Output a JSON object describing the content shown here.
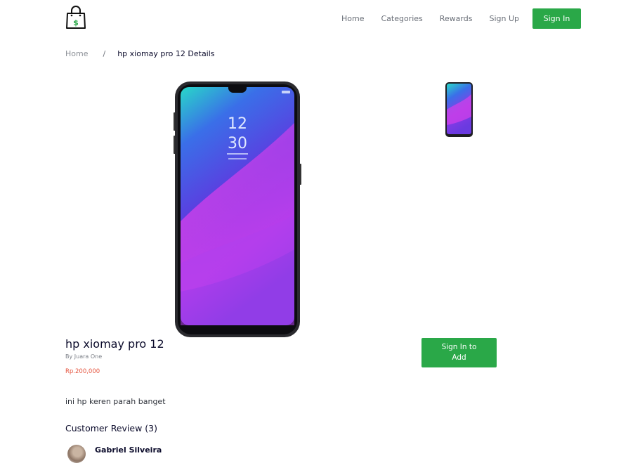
{
  "header": {
    "logo_icon": "shopping-bag-dollar-icon",
    "nav": [
      "Home",
      "Categories",
      "Rewards",
      "Sign Up"
    ],
    "sign_in_label": "Sign In"
  },
  "breadcrumb": {
    "home": "Home",
    "separator": "/",
    "current": "hp xiomay pro 12 Details"
  },
  "product": {
    "name": "hp xiomay pro 12",
    "seller": "By Juara One",
    "price": "Rp.200,000",
    "add_label": "Sign In to Add",
    "description": "ini hp keren parah banget",
    "screen_time": [
      "12",
      "30"
    ]
  },
  "reviews": {
    "heading": "Customer Review (3)",
    "first_reviewer": "Gabriel Silveira"
  },
  "colors": {
    "accent_green": "#2aa848",
    "price_red": "#e5533d",
    "text_dark": "#0b0b2b"
  }
}
